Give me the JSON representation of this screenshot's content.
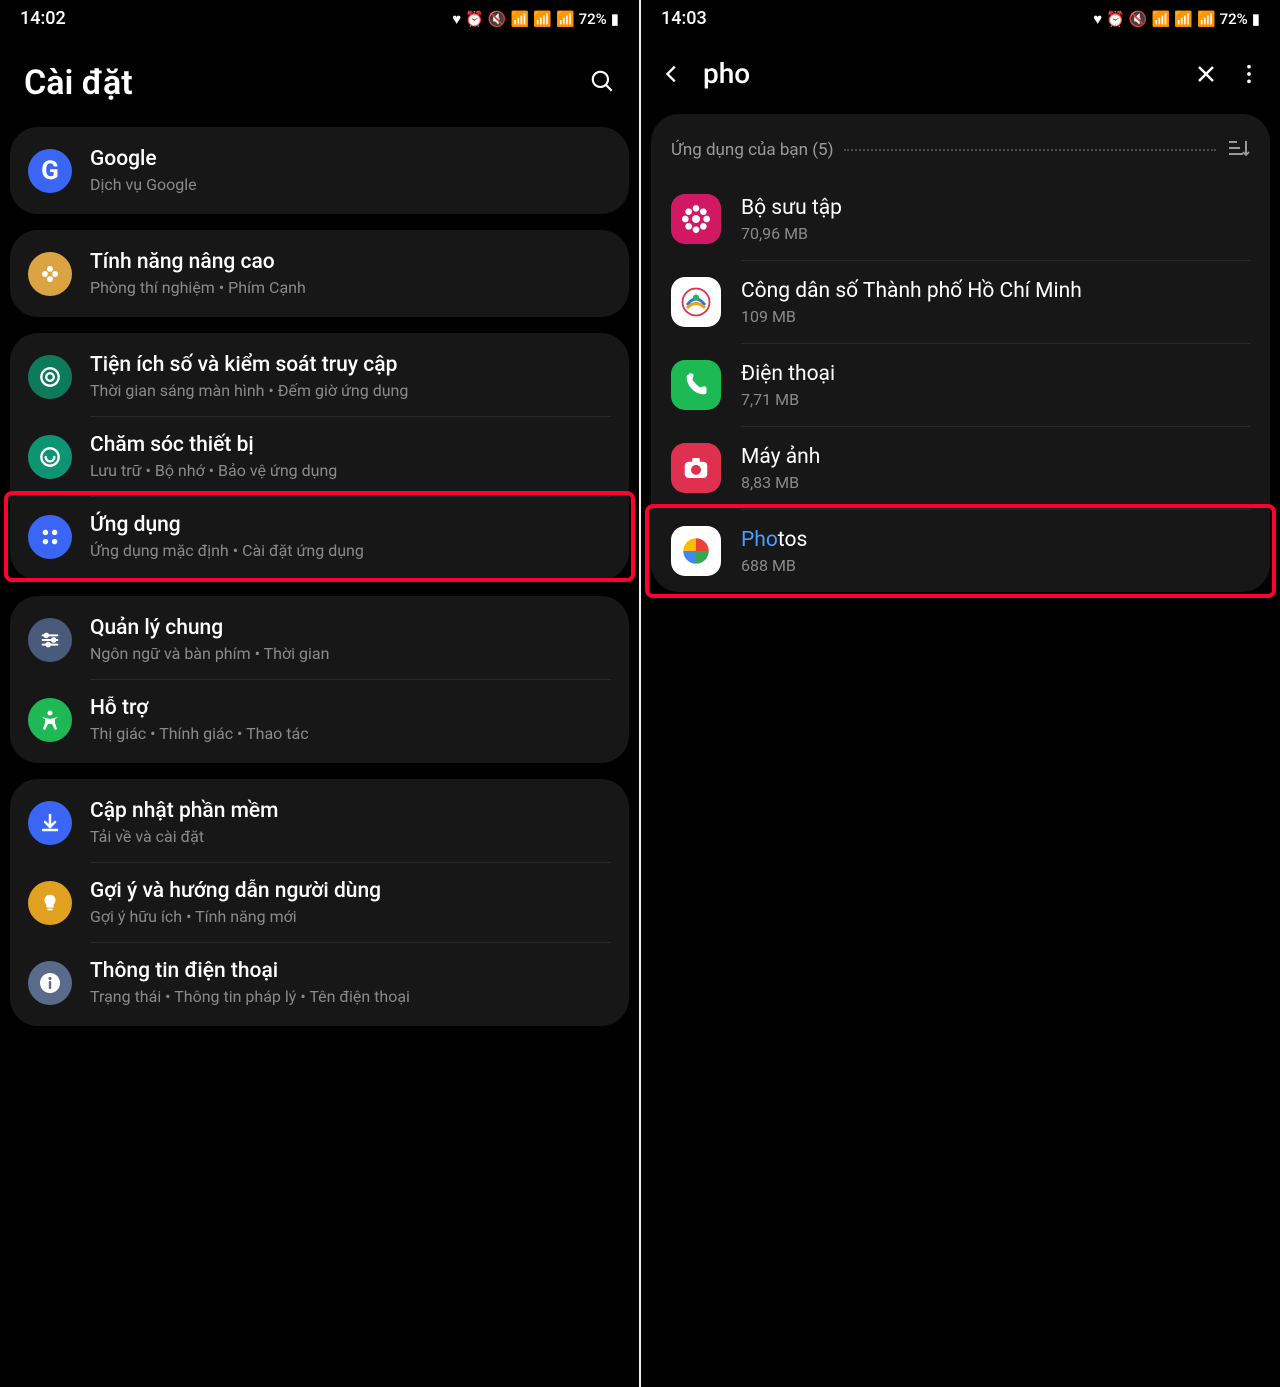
{
  "left": {
    "status": {
      "time": "14:02",
      "battery": "72%"
    },
    "header_title": "Cài đặt",
    "groups": [
      {
        "items": [
          {
            "icon": "google",
            "icon_bg": "#3b66f5",
            "title": "Google",
            "sub": "Dịch vụ Google"
          }
        ]
      },
      {
        "items": [
          {
            "icon": "flower",
            "icon_bg": "#d9a441",
            "title": "Tính năng nâng cao",
            "sub": "Phòng thí nghiệm  •  Phím Cạnh"
          }
        ]
      },
      {
        "items": [
          {
            "icon": "digital",
            "icon_bg": "#0c7a5b",
            "title": "Tiện ích số và kiểm soát truy cập",
            "sub": "Thời gian sáng màn hình  •  Đếm giờ ứng dụng"
          },
          {
            "icon": "care",
            "icon_bg": "#0d9473",
            "title": "Chăm sóc thiết bị",
            "sub": "Lưu trữ  •  Bộ nhớ  •  Bảo vệ ứng dụng"
          },
          {
            "icon": "apps",
            "icon_bg": "#3b66f5",
            "title": "Ứng dụng",
            "sub": "Ứng dụng mặc định  •  Cài đặt ứng dụng",
            "hl": true
          }
        ]
      },
      {
        "items": [
          {
            "icon": "general",
            "icon_bg": "#4a5a7a",
            "title": "Quản lý chung",
            "sub": "Ngôn ngữ và bàn phím  •  Thời gian"
          },
          {
            "icon": "access",
            "icon_bg": "#1eb955",
            "title": "Hỗ trợ",
            "sub": "Thị giác  •  Thính giác  •  Thao tác"
          }
        ]
      },
      {
        "items": [
          {
            "icon": "update",
            "icon_bg": "#3b66f5",
            "title": "Cập nhật phần mềm",
            "sub": "Tải về và cài đặt"
          },
          {
            "icon": "tips",
            "icon_bg": "#e0a020",
            "title": "Gợi ý và hướng dẫn người dùng",
            "sub": "Gợi ý hữu ích  •  Tính năng mới"
          },
          {
            "icon": "info",
            "icon_bg": "#5a6a8a",
            "title": "Thông tin điện thoại",
            "sub": "Trạng thái  •  Thông tin pháp lý  •  Tên điện thoại"
          }
        ]
      }
    ]
  },
  "right": {
    "status": {
      "time": "14:03",
      "battery": "72%"
    },
    "search_query": "pho",
    "section_label": "Ứng dụng của bạn (5)",
    "apps": [
      {
        "icon": "gallery",
        "icon_bg": "#d11863",
        "title": "Bộ sưu tập",
        "sub": "70,96 MB"
      },
      {
        "icon": "hcm",
        "icon_bg": "#ffffff",
        "title": "Công dân số Thành phố Hồ Chí Minh",
        "sub": "109 MB"
      },
      {
        "icon": "phone",
        "icon_bg": "#1db954",
        "title": "Điện thoại",
        "sub": "7,71 MB"
      },
      {
        "icon": "camera",
        "icon_bg": "#e03050",
        "title": "Máy ảnh",
        "sub": "8,83 MB"
      },
      {
        "icon": "photos",
        "icon_bg": "#ffffff",
        "title_prefix": "Pho",
        "title_suffix": "tos",
        "sub": "688 MB",
        "hl": true
      }
    ]
  }
}
